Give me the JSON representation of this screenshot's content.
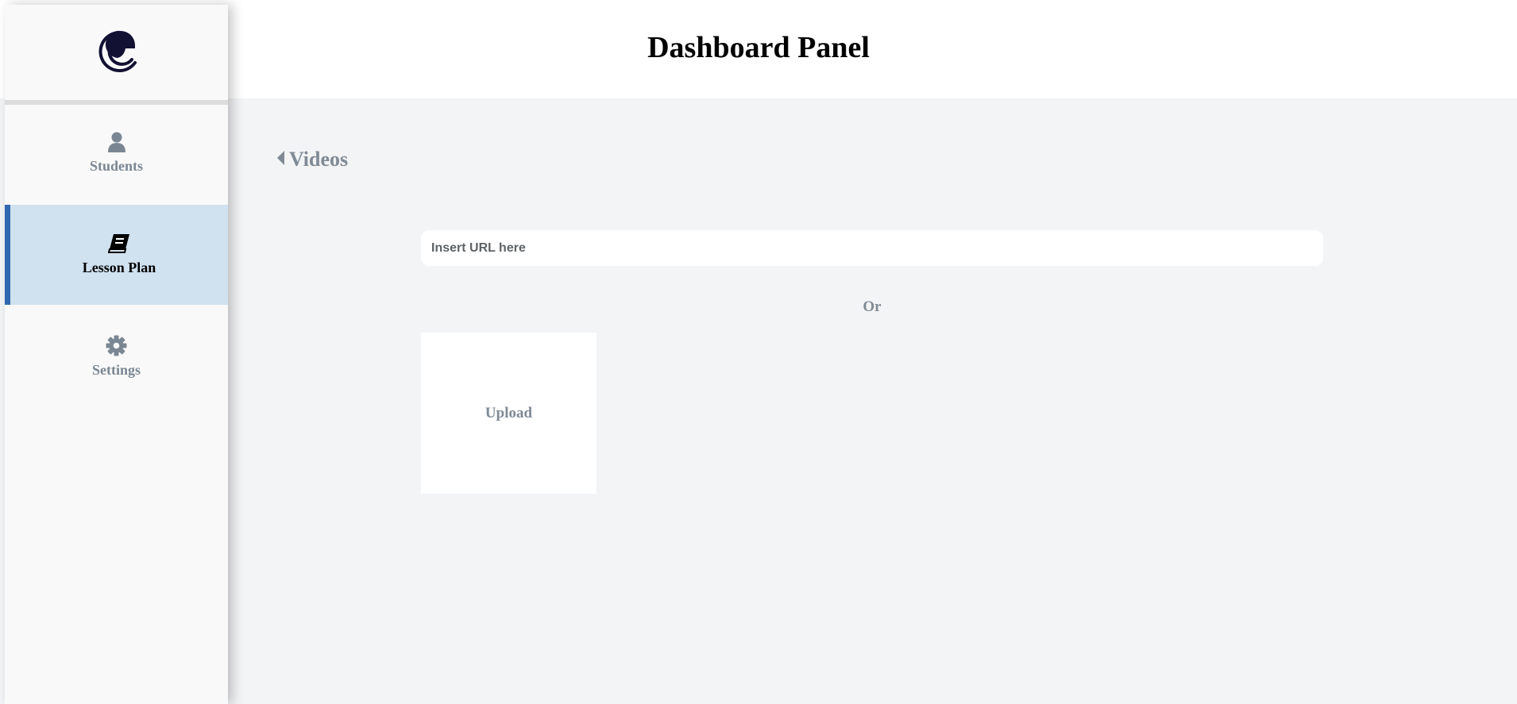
{
  "header": {
    "title": "Dashboard Panel"
  },
  "sidebar": {
    "logo": {
      "icon": "crescent-logo-icon",
      "color": "#121033"
    },
    "items": [
      {
        "label": "Students",
        "icon": "user-icon",
        "active": false
      },
      {
        "label": "Lesson Plan",
        "icon": "book-icon",
        "active": true
      },
      {
        "label": "Settings",
        "icon": "gear-icon",
        "active": false
      }
    ],
    "active_color": "#2f68b1",
    "active_background": "#d0e1ef"
  },
  "main": {
    "back_link": {
      "label": "Videos",
      "icon": "caret-left-icon"
    },
    "url_input": {
      "placeholder": "Insert URL here",
      "value": ""
    },
    "separator": "Or",
    "upload": {
      "label": "Upload"
    }
  }
}
